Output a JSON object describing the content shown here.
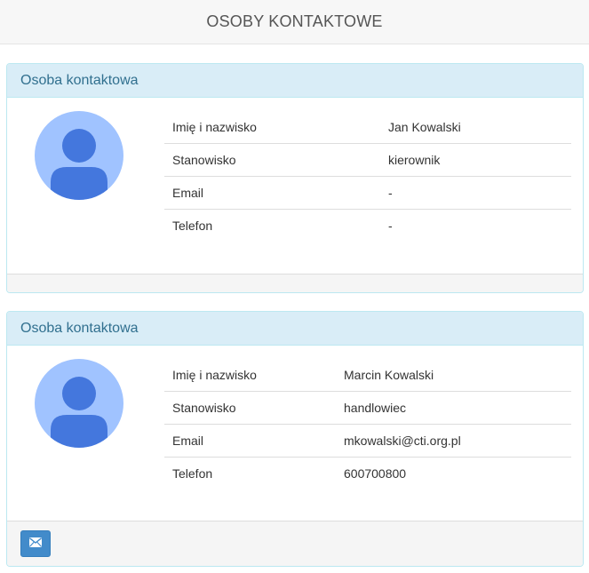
{
  "header": {
    "title": "OSOBY KONTAKTOWE"
  },
  "colors": {
    "avatar_bg": "#a0c3ff",
    "avatar_fg": "#4477dd",
    "mail_button": "#428bca",
    "panel_heading_bg": "#d9edf7",
    "panel_heading_text": "#31708f"
  },
  "contacts": [
    {
      "heading": "Osoba kontaktowa",
      "avatar_icon": "user-avatar-icon",
      "rows": [
        {
          "label": "Imię i nazwisko",
          "value": "Jan Kowalski"
        },
        {
          "label": "Stanowisko",
          "value": "kierownik"
        },
        {
          "label": "Email",
          "value": "-"
        },
        {
          "label": "Telefon",
          "value": "-"
        }
      ]
    },
    {
      "heading": "Osoba kontaktowa",
      "avatar_icon": "user-avatar-icon",
      "rows": [
        {
          "label": "Imię i nazwisko",
          "value": "Marcin Kowalski"
        },
        {
          "label": "Stanowisko",
          "value": "handlowiec"
        },
        {
          "label": "Email",
          "value": "mkowalski@cti.org.pl"
        },
        {
          "label": "Telefon",
          "value": "600700800"
        }
      ],
      "footer_button_icon": "envelope-icon"
    }
  ]
}
